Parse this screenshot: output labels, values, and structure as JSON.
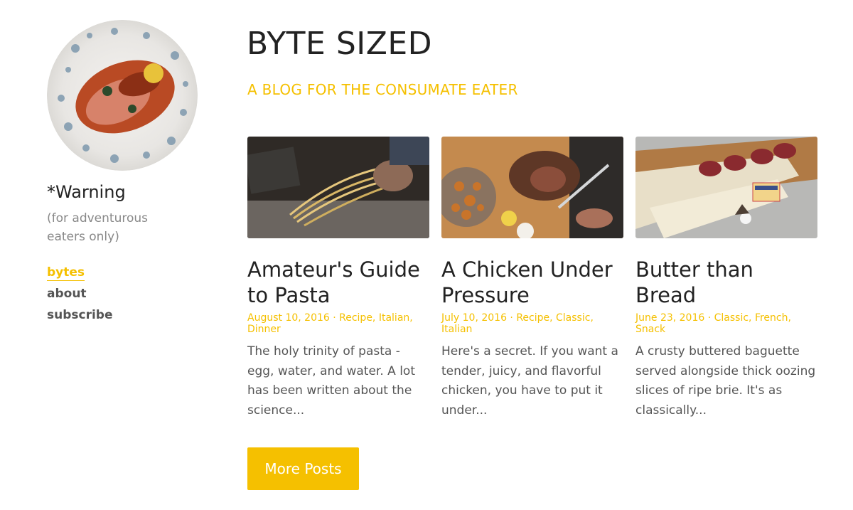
{
  "sidebar": {
    "avatar_icon": "plated-dish-photo",
    "warning": "*Warning",
    "tagline": "(for adventurous eaters only)",
    "nav": [
      {
        "label": "bytes",
        "active": true
      },
      {
        "label": "about",
        "active": false
      },
      {
        "label": "subscribe",
        "active": false
      }
    ]
  },
  "header": {
    "title": "BYTE SIZED",
    "subtitle": "A BLOG FOR THE CONSUMATE EATER"
  },
  "posts": [
    {
      "title": "Amateur's Guide to Pasta",
      "meta": "August 10, 2016 · Recipe, Italian, Dinner",
      "excerpt": "The holy trinity of pasta - egg, water, and water. A lot has been written about the science...",
      "image_icon": "pasta-photo"
    },
    {
      "title": "A Chicken Under Pressure",
      "meta": "July 10, 2016 · Recipe, Classic, Italian",
      "excerpt": "Here's a secret. If you want a tender, juicy, and flavorful chicken, you have to put it under...",
      "image_icon": "roast-chicken-photo"
    },
    {
      "title": "Butter than Bread",
      "meta": "June 23, 2016 · Classic, French, Snack",
      "excerpt": "A crusty buttered baguette served alongside thick oozing slices of ripe brie. It's as classically...",
      "image_icon": "baguette-photo"
    }
  ],
  "more_button": "More Posts",
  "colors": {
    "accent": "#f5c000",
    "text": "#222222",
    "muted": "#888888"
  }
}
